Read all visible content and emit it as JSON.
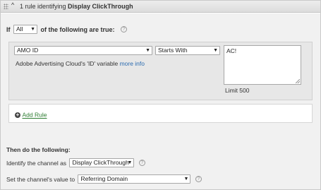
{
  "header": {
    "title_prefix": "1 rule identifying ",
    "title_bold": "Display ClickThrough"
  },
  "condition": {
    "if_label": "If",
    "match_select": "All",
    "suffix": "of the following are true:"
  },
  "rule": {
    "variable_select": "AMO ID",
    "operator_select": "Starts With",
    "value_text": "AC!",
    "description": "Adobe Advertising Cloud's 'ID' variable ",
    "more_info_link": "more info",
    "limit_text": "Limit 500"
  },
  "add_rule_label": "Add Rule",
  "then": {
    "title": "Then do the following:",
    "identify_label": "Identify the channel as",
    "channel_select": "Display ClickThrough",
    "set_value_label": "Set the channel's value to",
    "value_select": "Referring Domain"
  },
  "icons": {
    "grip": "drag-handle-icon",
    "collapse": "caret-up-icon",
    "help": "help-icon",
    "add": "plus-circle-icon",
    "dropdown": "chevron-down-icon"
  },
  "colors": {
    "link_blue": "#2b6bb0",
    "add_green": "#2e7d32",
    "panel_bg": "#f1f1f1"
  }
}
